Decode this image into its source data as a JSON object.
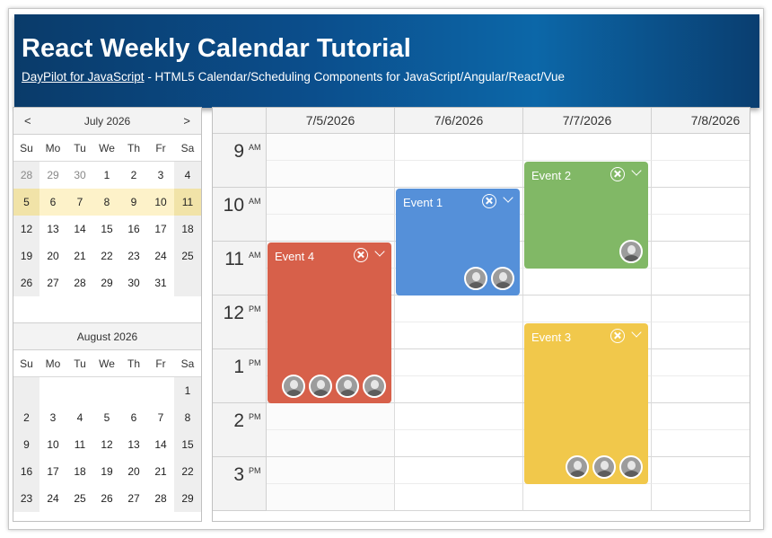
{
  "header": {
    "title": "React Weekly Calendar Tutorial",
    "link_text": "DayPilot for JavaScript",
    "subtitle_rest": " - HTML5 Calendar/Scheduling Components for JavaScript/Angular/React/Vue"
  },
  "navigator": {
    "day_names": [
      "Su",
      "Mo",
      "Tu",
      "We",
      "Th",
      "Fr",
      "Sa"
    ],
    "prev_icon": "<",
    "next_icon": ">",
    "months": [
      {
        "title": "July 2026",
        "weeks": [
          [
            "28",
            "29",
            "30",
            "1",
            "2",
            "3",
            "4"
          ],
          [
            "5",
            "6",
            "7",
            "8",
            "9",
            "10",
            "11"
          ],
          [
            "12",
            "13",
            "14",
            "15",
            "16",
            "17",
            "18"
          ],
          [
            "19",
            "20",
            "21",
            "22",
            "23",
            "24",
            "25"
          ],
          [
            "26",
            "27",
            "28",
            "29",
            "30",
            "31",
            ""
          ]
        ],
        "selected_week": 1,
        "other_month_cells": [
          [
            0,
            0
          ],
          [
            0,
            1
          ],
          [
            0,
            2
          ]
        ]
      },
      {
        "title": "August 2026",
        "weeks": [
          [
            "",
            "",
            "",
            "",
            "",
            "",
            "1"
          ],
          [
            "2",
            "3",
            "4",
            "5",
            "6",
            "7",
            "8"
          ],
          [
            "9",
            "10",
            "11",
            "12",
            "13",
            "14",
            "15"
          ],
          [
            "16",
            "17",
            "18",
            "19",
            "20",
            "21",
            "22"
          ],
          [
            "23",
            "24",
            "25",
            "26",
            "27",
            "28",
            "29"
          ]
        ],
        "selected_week": -1,
        "other_month_cells": []
      }
    ]
  },
  "calendar": {
    "columns": [
      "7/5/2026",
      "7/6/2026",
      "7/7/2026",
      "7/8/2026"
    ],
    "hours": [
      {
        "hour": "9",
        "ampm": "AM"
      },
      {
        "hour": "10",
        "ampm": "AM"
      },
      {
        "hour": "11",
        "ampm": "AM"
      },
      {
        "hour": "12",
        "ampm": "PM"
      },
      {
        "hour": "1",
        "ampm": "PM"
      },
      {
        "hour": "2",
        "ampm": "PM"
      },
      {
        "hour": "3",
        "ampm": "PM"
      }
    ],
    "events": [
      {
        "title": "Event 1",
        "column": "7/6/2026",
        "start": "10:00 AM",
        "end": "12:00 PM",
        "color": "#5590d9",
        "participants": 2
      },
      {
        "title": "Event 2",
        "column": "7/7/2026",
        "start": "9:30 AM",
        "end": "11:30 AM",
        "color": "#81b866",
        "participants": 1
      },
      {
        "title": "Event 3",
        "column": "7/7/2026",
        "start": "12:30 PM",
        "end": "3:30 PM",
        "color": "#f1c84b",
        "participants": 3
      },
      {
        "title": "Event 4",
        "column": "7/5/2026",
        "start": "11:00 AM",
        "end": "2:00 PM",
        "color": "#d7604a",
        "participants": 4
      }
    ],
    "event_icons": {
      "delete": "circle-x-icon",
      "menu": "chevron-down-icon",
      "participant": "avatar-icon"
    }
  }
}
